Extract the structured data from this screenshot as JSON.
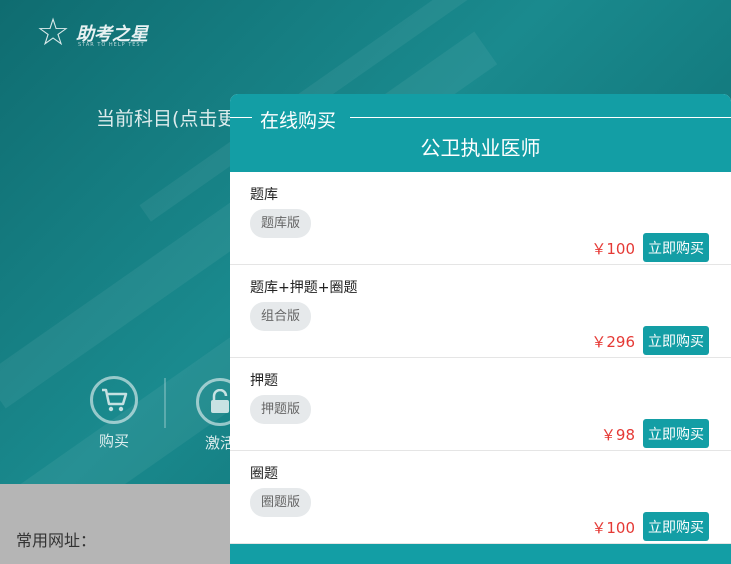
{
  "app": {
    "logo_brand": "助考之星",
    "logo_tagline": "STAR TO HELP TEST",
    "subject_label": "当前科目(点击更",
    "actions": [
      {
        "label": "购买",
        "icon": "cart-icon"
      },
      {
        "label": "激活",
        "icon": "lock-icon"
      }
    ],
    "links_label": "常用网址："
  },
  "modal": {
    "title": "在线购买",
    "subtitle": "公卫执业医师",
    "buy_label": "立即购买",
    "plans": [
      {
        "name": "题库",
        "tag": "题库版",
        "price": "￥100"
      },
      {
        "name": "题库+押题+圈题",
        "tag": "组合版",
        "price": "￥296"
      },
      {
        "name": "押题",
        "tag": "押题版",
        "price": "￥98"
      },
      {
        "name": "圈题",
        "tag": "圈题版",
        "price": "￥100"
      }
    ]
  },
  "colors": {
    "accent": "#139ea5",
    "price": "#e53935",
    "background_teal": "#137a7e"
  }
}
